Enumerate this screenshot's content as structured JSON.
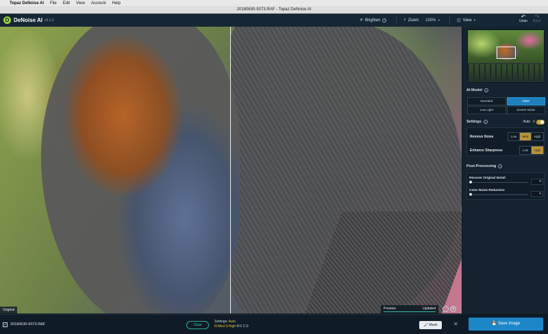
{
  "menubar": {
    "app": "Topaz DeNoise AI",
    "items": [
      "File",
      "Edit",
      "View",
      "Account",
      "Help"
    ]
  },
  "window": {
    "title": "20180630-5073.RAF - Topaz DeNoise AI"
  },
  "header": {
    "logo_letter": "D",
    "app_name": "DeNoise AI",
    "version": "v3.1.2",
    "brighten_label": "Brighten",
    "zoom_label": "Zoom",
    "zoom_value": "100%",
    "view_label": "View",
    "undo_label": "Undo",
    "redo_label": "Redo"
  },
  "viewport": {
    "original_label": "Original",
    "preview_label": "Preview",
    "preview_status": "Updated",
    "preview_progress": 1.0
  },
  "panel": {
    "ai_model_title": "AI Model",
    "models": [
      {
        "label": "Standard",
        "active": false
      },
      {
        "label": "Clear",
        "active": true
      },
      {
        "label": "Low Light",
        "active": false
      },
      {
        "label": "Severe Noise",
        "active": false
      }
    ],
    "settings_title": "Settings",
    "auto_label": "Auto",
    "remove_noise": {
      "label": "Remove Noise",
      "options": [
        "Low",
        "Med",
        "High"
      ],
      "selected": "Med"
    },
    "enhance_sharpness": {
      "label": "Enhance Sharpness",
      "options": [
        "Low",
        "High"
      ],
      "selected": "High"
    },
    "post_processing_title": "Post-Processing",
    "recover_detail": {
      "label": "Recover Original Detail",
      "value": "0",
      "level": 0
    },
    "color_noise": {
      "label": "Color Noise Reduction",
      "value": "0",
      "level": 0
    }
  },
  "bottom": {
    "filename": "20180630-5073.RAF",
    "clear_label": "Clear",
    "settings_line1_prefix": "Settings: ",
    "settings_line1_value": "Auto",
    "n_label": "N:",
    "n_value": "Med",
    "s_label": "S:",
    "s_value": "High",
    "r_label": "R:",
    "r_value": "0",
    "c_label": "C:",
    "c_value": "0",
    "mask_label": "Mask",
    "save_label": "Save Image"
  },
  "colors": {
    "accent_blue": "#1e7fbf",
    "accent_gold": "#b9933a",
    "accent_teal": "#2fb090",
    "panel_bg": "#14232f"
  }
}
